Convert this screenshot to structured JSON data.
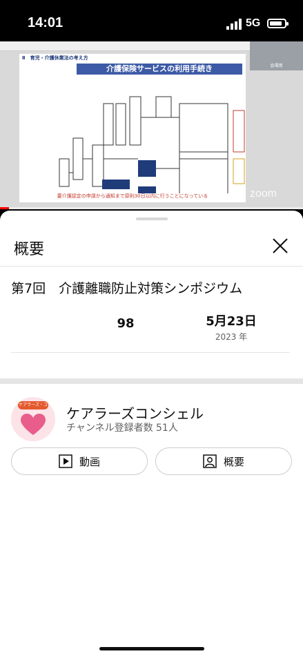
{
  "status_bar": {
    "time": "14:01",
    "network": "5G"
  },
  "video": {
    "slide_heading": "Ⅱ　育児・介護休業法の考え方",
    "slide_title": "介護保険サービスの利用手続き",
    "slide_note": "要介護認定の申請から通知まで原則30日以内に行うことになっている",
    "speaker_label": "会場用",
    "watermark": "zoom",
    "progress_percent": 3
  },
  "sheet": {
    "title": "概要",
    "video_title": "第7回　介護離職防止対策シンポジウム",
    "stats": {
      "likes": "98",
      "date_main": "5月23日",
      "date_sub": "2023 年"
    },
    "channel": {
      "name": "ケアラーズコンシェル",
      "subscribers": "チャンネル登録者数 51人",
      "avatar_tag": "ケアラーズ・コンシェル"
    },
    "buttons": {
      "videos_label": "動画",
      "about_label": "概要"
    }
  }
}
